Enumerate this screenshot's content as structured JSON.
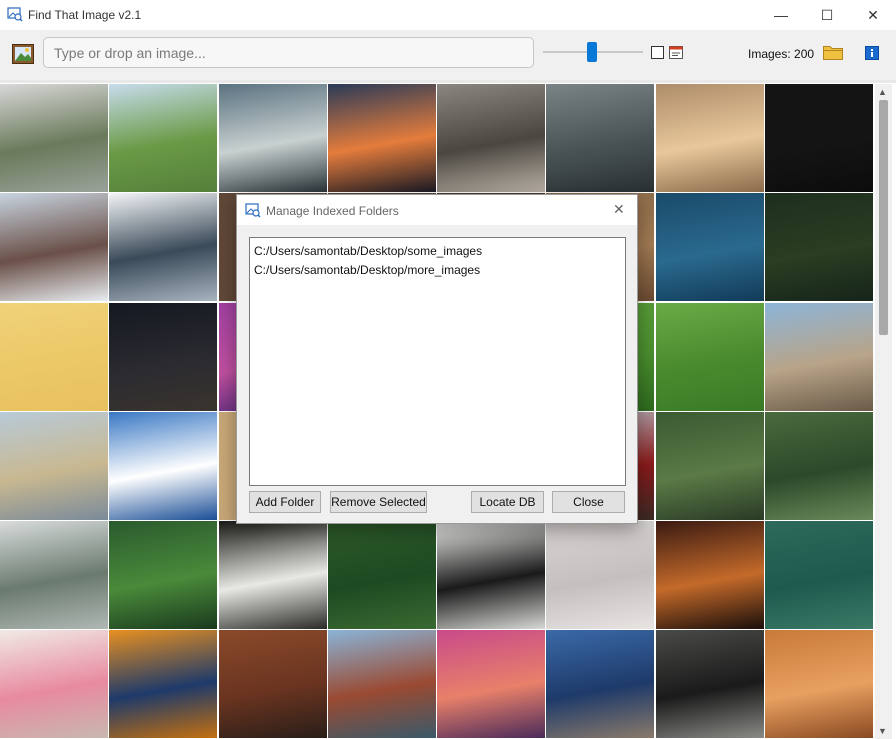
{
  "window": {
    "title": "Find That Image v2.1",
    "minimize": "—",
    "maximize": "☐",
    "close": "✕"
  },
  "toolbar": {
    "search_placeholder": "Type or drop an image...",
    "slider_value": 0.5,
    "checkbox_checked": false,
    "images_count": "Images: 200"
  },
  "grid": {
    "columns": 8,
    "tiles": [
      {
        "name": "tile-plant-window",
        "colors": [
          "#d8d8d8",
          "#6a7a5a",
          "#9aa29a"
        ]
      },
      {
        "name": "tile-hiker-mountain",
        "colors": [
          "#c7dcec",
          "#6a9a46",
          "#54803a"
        ]
      },
      {
        "name": "tile-ocean-waves",
        "colors": [
          "#5a7280",
          "#c8d0d0",
          "#2a3438"
        ]
      },
      {
        "name": "tile-sunset-sky",
        "colors": [
          "#2a3a58",
          "#e47c3c",
          "#1a1a24"
        ]
      },
      {
        "name": "tile-driftwood",
        "colors": [
          "#8a8680",
          "#4a4640",
          "#b8b0a4"
        ]
      },
      {
        "name": "tile-rain-glass",
        "colors": [
          "#7a8486",
          "#4a5456",
          "#2a3032"
        ]
      },
      {
        "name": "tile-puppy",
        "colors": [
          "#ad8c6a",
          "#e8c89a",
          "#8a6a4a"
        ]
      },
      {
        "name": "tile-moon",
        "colors": [
          "#141414",
          "#141414",
          "#0c0c0c"
        ]
      },
      {
        "name": "tile-cloud-mountain",
        "colors": [
          "#c8d4e0",
          "#6a5048",
          "#e8ecf0"
        ]
      },
      {
        "name": "tile-skyscraper",
        "colors": [
          "#f4f6f8",
          "#3a4a58",
          "#a8b4c0"
        ]
      },
      {
        "name": "tile-hidden-1",
        "colors": [
          "#604838",
          "#604838",
          "#604838"
        ]
      },
      {
        "name": "tile-hidden-2",
        "colors": [
          "#5a4838",
          "#5a4838",
          "#5a4838"
        ]
      },
      {
        "name": "tile-hidden-3",
        "colors": [
          "#4a3a2a",
          "#4a3a2a",
          "#4a3a2a"
        ]
      },
      {
        "name": "tile-hidden-4",
        "colors": [
          "#8a6a4a",
          "#a07a52",
          "#6a4a32"
        ]
      },
      {
        "name": "tile-water-ripples",
        "colors": [
          "#1a4a6a",
          "#2a6a8e",
          "#123a58"
        ]
      },
      {
        "name": "tile-orange-tree",
        "colors": [
          "#1e2e1e",
          "#2a3e22",
          "#16241a"
        ]
      },
      {
        "name": "tile-yellow-wall",
        "colors": [
          "#f0d27a",
          "#ecc866",
          "#e8c060"
        ]
      },
      {
        "name": "tile-night-arch",
        "colors": [
          "#141820",
          "#2a2a30",
          "#3a342e"
        ]
      },
      {
        "name": "tile-hidden-5",
        "colors": [
          "#a040a0",
          "#c050a0",
          "#502878"
        ]
      },
      {
        "name": "tile-hidden-6",
        "colors": [
          "#888888",
          "#888888",
          "#888888"
        ]
      },
      {
        "name": "tile-hidden-7",
        "colors": [
          "#888888",
          "#888888",
          "#888888"
        ]
      },
      {
        "name": "tile-leaf-drops",
        "colors": [
          "#5aa03a",
          "#4a8e2e",
          "#2e6a1e"
        ]
      },
      {
        "name": "tile-leaf-drops-2",
        "colors": [
          "#6aaa46",
          "#4a8a2e",
          "#3a7a26"
        ]
      },
      {
        "name": "tile-valley-view",
        "colors": [
          "#8cb4d8",
          "#b8a488",
          "#6a5a48"
        ]
      },
      {
        "name": "tile-lake-reeds",
        "colors": [
          "#b8cad8",
          "#c8b890",
          "#7a8a9a"
        ]
      },
      {
        "name": "tile-climber-peak",
        "colors": [
          "#3a78c4",
          "#ffffff",
          "#1a4e96"
        ]
      },
      {
        "name": "tile-hidden-8",
        "colors": [
          "#c8a878",
          "#c8a878",
          "#c8a878"
        ]
      },
      {
        "name": "tile-hidden-9",
        "colors": [
          "#888888",
          "#888888",
          "#888888"
        ]
      },
      {
        "name": "tile-hidden-10",
        "colors": [
          "#888888",
          "#888888",
          "#888888"
        ]
      },
      {
        "name": "tile-red-forest",
        "colors": [
          "#b8c0c8",
          "#8a1a1a",
          "#3a2a24"
        ]
      },
      {
        "name": "tile-green-valley",
        "colors": [
          "#3a5a32",
          "#5a7a46",
          "#2a3a26"
        ]
      },
      {
        "name": "tile-waterfall",
        "colors": [
          "#4a6a3e",
          "#2a4a2a",
          "#6a8a5a"
        ]
      },
      {
        "name": "tile-foggy-coast",
        "colors": [
          "#d8dcdc",
          "#6a7a6e",
          "#b0b8b4"
        ]
      },
      {
        "name": "tile-fern-hand",
        "colors": [
          "#2a5a2e",
          "#4a8a3a",
          "#1a3a1e"
        ]
      },
      {
        "name": "tile-llama",
        "colors": [
          "#1a1a16",
          "#e8e8e4",
          "#2a2a26"
        ]
      },
      {
        "name": "tile-palm-leaves",
        "colors": [
          "#2e5a2a",
          "#1e4a22",
          "#3a6a32"
        ]
      },
      {
        "name": "tile-shadow-dancer",
        "colors": [
          "#f4f4f2",
          "#1a1a1a",
          "#d8d8d6"
        ]
      },
      {
        "name": "tile-water-drop",
        "colors": [
          "#d8d4d2",
          "#c4c0c0",
          "#e8e4e2"
        ]
      },
      {
        "name": "tile-hooded-man",
        "colors": [
          "#3a1a12",
          "#c46a2a",
          "#1a0e0a"
        ]
      },
      {
        "name": "tile-pink-lotus",
        "colors": [
          "#2e6a5a",
          "#1e5a4e",
          "#3a7a66"
        ]
      },
      {
        "name": "tile-peony",
        "colors": [
          "#f0eae6",
          "#e88aa0",
          "#c8b8b0"
        ]
      },
      {
        "name": "tile-autumn-tree",
        "colors": [
          "#e89020",
          "#1e3a6a",
          "#c47010"
        ]
      },
      {
        "name": "tile-old-window",
        "colors": [
          "#8a4a2a",
          "#6a3420",
          "#2a1e18"
        ]
      },
      {
        "name": "tile-rocky-sea",
        "colors": [
          "#8ab4d8",
          "#9a4a32",
          "#3a5a6a"
        ]
      },
      {
        "name": "tile-sailboats",
        "colors": [
          "#c84a8a",
          "#e8806a",
          "#4a2a5a"
        ]
      },
      {
        "name": "tile-pier-lake",
        "colors": [
          "#3a6aa8",
          "#1e3a6a",
          "#8a7a6a"
        ]
      },
      {
        "name": "tile-surfer",
        "colors": [
          "#4a4a48",
          "#1a1a1a",
          "#8a8a86"
        ]
      },
      {
        "name": "tile-golden-dog",
        "colors": [
          "#c87a3a",
          "#e8a060",
          "#8a4a22"
        ]
      }
    ]
  },
  "dialog": {
    "title": "Manage Indexed Folders",
    "close": "✕",
    "folders": [
      "C:/Users/samontab/Desktop/some_images",
      "C:/Users/samontab/Desktop/more_images"
    ],
    "buttons": {
      "add": "Add Folder",
      "remove": "Remove Selected",
      "locate": "Locate DB",
      "close": "Close"
    }
  },
  "scrollbar": {
    "up": "▲",
    "down": "▼"
  }
}
